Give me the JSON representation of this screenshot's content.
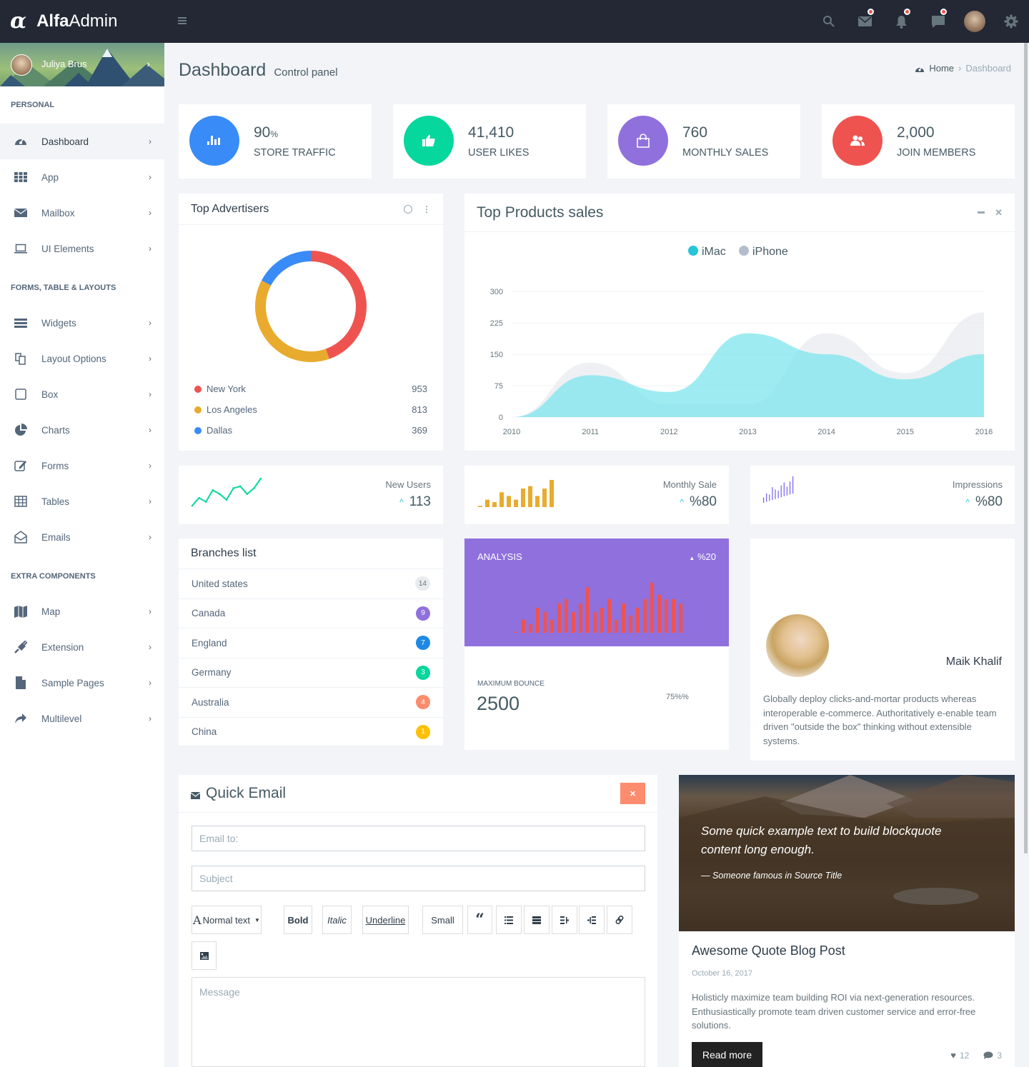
{
  "brand": {
    "bold": "Alfa",
    "light": "Admin"
  },
  "topbar": {
    "icons": [
      "search-icon",
      "mail-icon",
      "bell-icon",
      "chat-icon",
      "user-avatar",
      "gear-icon"
    ]
  },
  "sidebar": {
    "user_name": "Juliya Brus",
    "sections": [
      {
        "caption": "PERSONAL",
        "items": [
          {
            "label": "Dashboard",
            "icon": "dashboard-icon",
            "active": true
          },
          {
            "label": "App",
            "icon": "grid-icon"
          },
          {
            "label": "Mailbox",
            "icon": "envelope-icon"
          },
          {
            "label": "UI Elements",
            "icon": "laptop-icon"
          }
        ]
      },
      {
        "caption": "FORMS, TABLE & LAYOUTS",
        "items": [
          {
            "label": "Widgets",
            "icon": "bars-icon"
          },
          {
            "label": "Layout Options",
            "icon": "copy-icon"
          },
          {
            "label": "Box",
            "icon": "square-icon"
          },
          {
            "label": "Charts",
            "icon": "pie-chart-icon"
          },
          {
            "label": "Forms",
            "icon": "edit-icon"
          },
          {
            "label": "Tables",
            "icon": "table-icon"
          },
          {
            "label": "Emails",
            "icon": "envelope-open-icon"
          }
        ]
      },
      {
        "caption": "EXTRA COMPONENTS",
        "items": [
          {
            "label": "Map",
            "icon": "map-icon"
          },
          {
            "label": "Extension",
            "icon": "plug-icon"
          },
          {
            "label": "Sample Pages",
            "icon": "file-icon"
          },
          {
            "label": "Multilevel",
            "icon": "share-icon"
          }
        ]
      }
    ]
  },
  "header": {
    "title": "Dashboard",
    "subtitle": "Control panel",
    "breadcrumb": {
      "home": "Home",
      "current": "Dashboard"
    }
  },
  "stats": [
    {
      "value": "90",
      "unit": "%",
      "label": "STORE TRAFFIC",
      "color": "#398bf7",
      "icon": "bar-chart-icon"
    },
    {
      "value": "41,410",
      "unit": "",
      "label": "USER LIKES",
      "color": "#06d79c",
      "icon": "thumbs-up-icon"
    },
    {
      "value": "760",
      "unit": "",
      "label": "MONTHLY SALES",
      "color": "#9070dd",
      "icon": "shopping-bag-icon"
    },
    {
      "value": "2,000",
      "unit": "",
      "label": "JOIN MEMBERS",
      "color": "#ef5350",
      "icon": "users-icon"
    }
  ],
  "top_advertisers": {
    "title": "Top Advertisers"
  },
  "top_products": {
    "title": "Top Products sales"
  },
  "spark_cards": [
    {
      "label": "New Users",
      "value": "113"
    },
    {
      "label": "Monthly Sale",
      "value": "%80"
    },
    {
      "label": "Impressions",
      "value": "%80"
    }
  ],
  "branches": {
    "title": "Branches list",
    "items": [
      {
        "name": "United states",
        "count": "14",
        "color": "#e9ecef",
        "text": "#67757c"
      },
      {
        "name": "Canada",
        "count": "9",
        "color": "#9070dd",
        "text": "#fff"
      },
      {
        "name": "England",
        "count": "7",
        "color": "#1e88e5",
        "text": "#fff"
      },
      {
        "name": "Germany",
        "count": "3",
        "color": "#06d79c",
        "text": "#fff"
      },
      {
        "name": "Australia",
        "count": "4",
        "color": "#fc8c6d",
        "text": "#fff"
      },
      {
        "name": "China",
        "count": "1",
        "color": "#ffc107",
        "text": "#fff"
      }
    ]
  },
  "analysis": {
    "title": "ANALYSIS",
    "change": "%20",
    "max_label": "MAXIMUM BOUNCE",
    "max_value": "2500",
    "pct": "75%%"
  },
  "profile_card": {
    "name": "Maik Khalif",
    "bio": "Globally deploy clicks-and-mortar products whereas interoperable e-commerce. Authoritatively e-enable team driven \"outside the box\" thinking without extensible systems."
  },
  "quick_email": {
    "title": "Quick Email",
    "email_placeholder": "Email to:",
    "subject_placeholder": "Subject",
    "message_placeholder": "Message",
    "toolbar": {
      "format": "Normal text",
      "bold": "Bold",
      "italic": "Italic",
      "underline": "Underline",
      "small": "Small"
    }
  },
  "blog": {
    "quote": "Some quick example text to build blockquote content long enough.",
    "quote_source": "— Someone famous in Source Title",
    "title": "Awesome Quote Blog Post",
    "date": "October 16, 2017",
    "body": "Holisticly maximize team building ROI via next-generation resources. Enthusiastically promote team driven customer service and error-free solutions.",
    "read_more": "Read more",
    "likes": "12",
    "comments": "3"
  },
  "chart_data": [
    {
      "type": "pie",
      "title": "Top Advertisers",
      "categories": [
        "New York",
        "Los Angeles",
        "Dallas"
      ],
      "values": [
        953,
        813,
        369
      ],
      "colors": [
        "#ef5350",
        "#e9ab2e",
        "#398bf7"
      ],
      "donut": true
    },
    {
      "type": "area",
      "title": "Top Products sales",
      "x": [
        "2010",
        "2011",
        "2012",
        "2013",
        "2014",
        "2015",
        "2016"
      ],
      "series": [
        {
          "name": "iMac",
          "values": [
            0,
            100,
            60,
            200,
            150,
            90,
            150
          ],
          "color": "#26c6da"
        },
        {
          "name": "iPhone",
          "values": [
            0,
            130,
            30,
            30,
            200,
            105,
            250
          ],
          "color": "#b4becb"
        }
      ],
      "ylim": [
        0,
        300
      ],
      "yticks": [
        0,
        75,
        150,
        225,
        300
      ],
      "legend": "top-center",
      "grid": true
    },
    {
      "type": "line",
      "title": "New Users",
      "values": [
        4,
        8,
        6,
        12,
        10,
        7,
        13,
        14,
        10,
        13,
        18
      ]
    },
    {
      "type": "bar",
      "title": "Monthly Sale",
      "values": [
        1,
        6,
        4,
        12,
        9,
        6,
        15,
        17,
        9,
        15,
        22
      ]
    },
    {
      "type": "bar",
      "title": "Impressions",
      "values": [
        5,
        8,
        6,
        12,
        9,
        7,
        11,
        13,
        8,
        12,
        16
      ]
    },
    {
      "type": "bar",
      "title": "Analysis",
      "values": [
        1,
        12,
        8,
        23,
        19,
        12,
        27,
        31,
        19,
        27,
        42,
        19,
        23,
        31,
        12,
        27,
        16,
        23,
        31,
        46,
        35,
        31,
        31,
        27
      ]
    }
  ]
}
